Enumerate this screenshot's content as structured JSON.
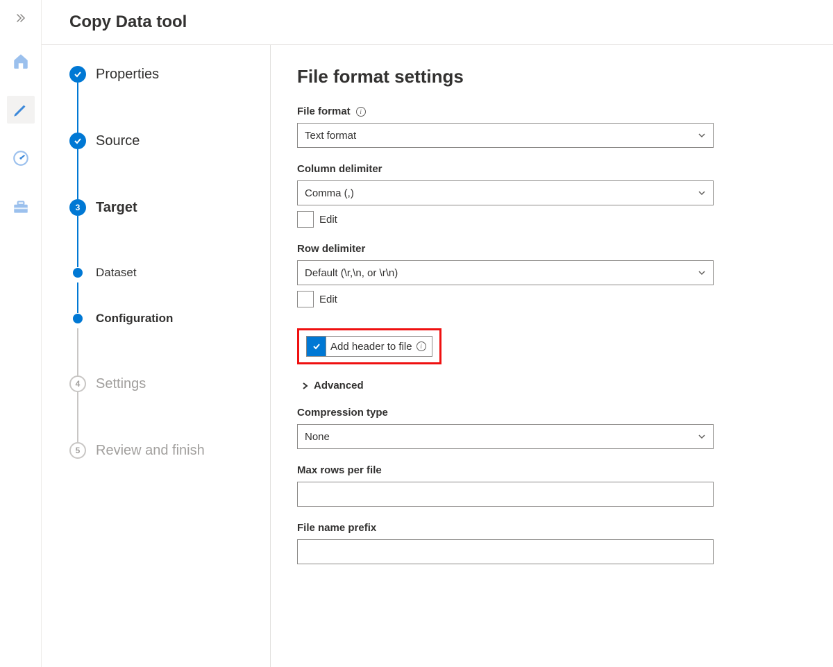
{
  "title": "Copy Data tool",
  "stepper": {
    "properties": "Properties",
    "source": "Source",
    "target": "Target",
    "target_number": "3",
    "dataset": "Dataset",
    "configuration": "Configuration",
    "settings": "Settings",
    "settings_number": "4",
    "review": "Review and finish",
    "review_number": "5"
  },
  "form": {
    "heading": "File format settings",
    "file_format_label": "File format",
    "file_format_value": "Text format",
    "column_delimiter_label": "Column delimiter",
    "column_delimiter_value": "Comma (,)",
    "column_delimiter_edit": "Edit",
    "row_delimiter_label": "Row delimiter",
    "row_delimiter_value": "Default (\\r,\\n, or \\r\\n)",
    "row_delimiter_edit": "Edit",
    "add_header_label": "Add header to file",
    "advanced_label": "Advanced",
    "compression_type_label": "Compression type",
    "compression_type_value": "None",
    "max_rows_label": "Max rows per file",
    "max_rows_value": "",
    "file_name_prefix_label": "File name prefix",
    "file_name_prefix_value": ""
  }
}
